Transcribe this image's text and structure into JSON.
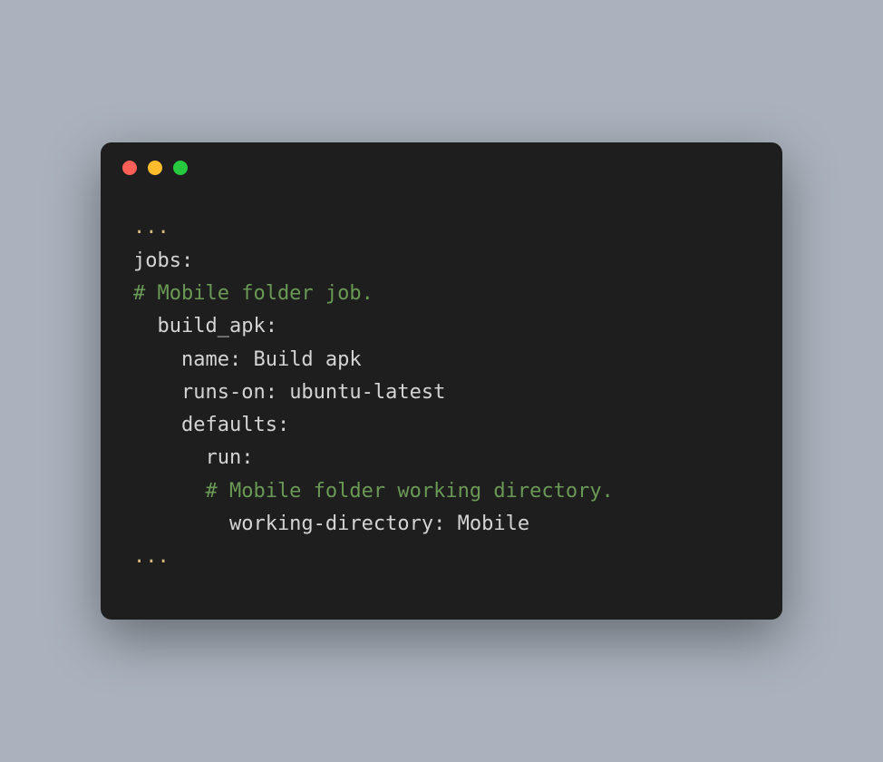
{
  "code": {
    "line1": "...",
    "line2": "",
    "line3_key": "jobs:",
    "line4_comment": "# Mobile folder job.",
    "line5_key": "  build_apk:",
    "line6_key": "    name: ",
    "line6_value": "Build apk",
    "line7_key": "    runs-on: ",
    "line7_value": "ubuntu-latest",
    "line8_key": "    defaults:",
    "line9_key": "      run:",
    "line10_comment": "      # Mobile folder working directory.",
    "line11_key": "        working-directory: ",
    "line11_value": "Mobile",
    "line12": "",
    "line13": "..."
  }
}
